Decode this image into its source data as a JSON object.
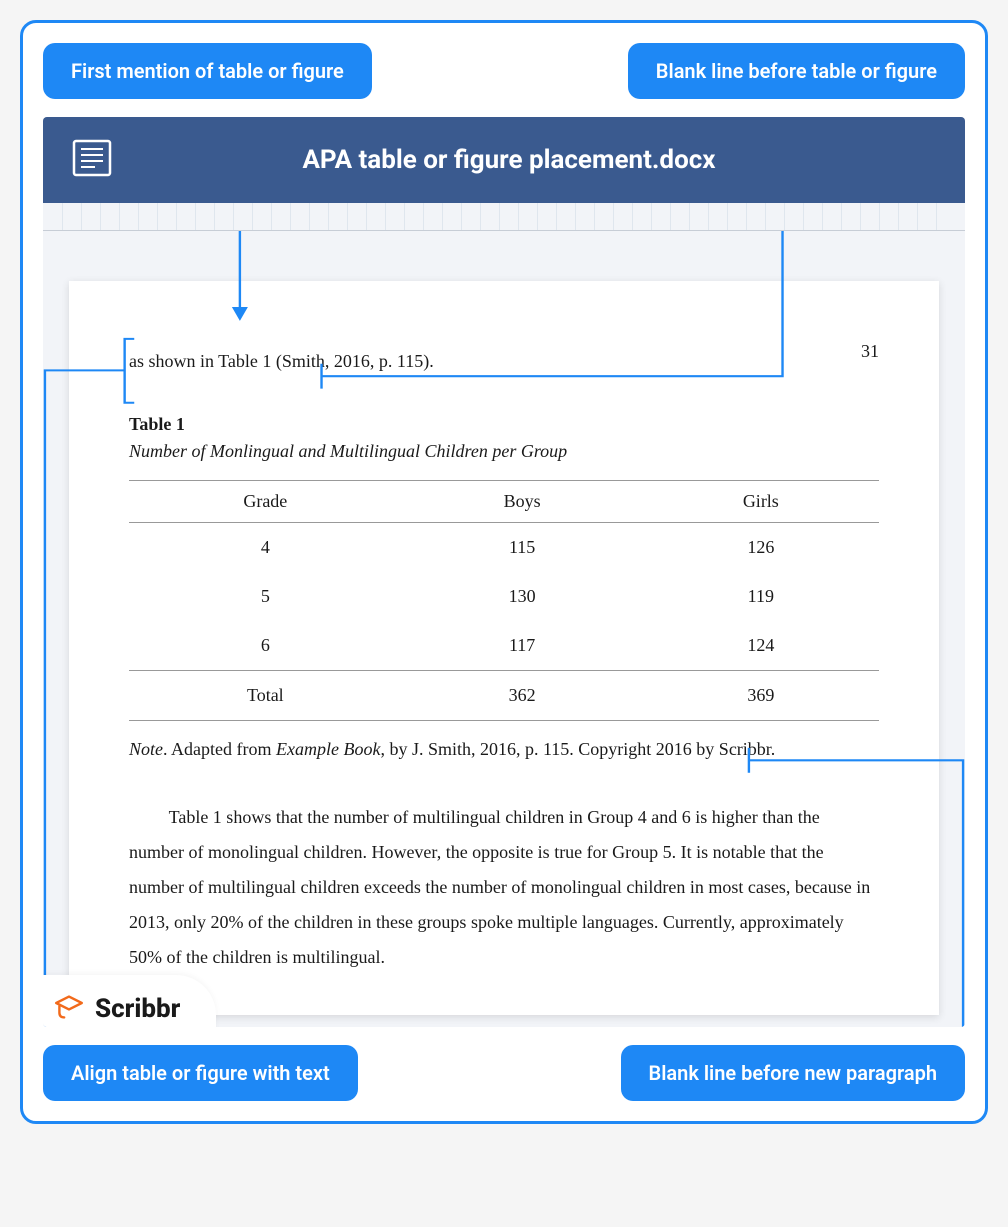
{
  "callouts": {
    "top_left": "First mention of table or figure",
    "top_right": "Blank line before table or figure",
    "bottom_left": "Align table or figure with text",
    "bottom_right": "Blank line before new paragraph"
  },
  "window": {
    "title": "APA table or figure placement.docx"
  },
  "page": {
    "number": "31",
    "intro": "as shown in Table 1 (Smith, 2016, p. 115).",
    "table_label": "Table 1",
    "table_title": "Number of Monlingual and Multilingual Children per Group",
    "columns": [
      "Grade",
      "Boys",
      "Girls"
    ],
    "rows": [
      {
        "grade": "4",
        "boys": "115",
        "girls": "126"
      },
      {
        "grade": "5",
        "boys": "130",
        "girls": "119"
      },
      {
        "grade": "6",
        "boys": "117",
        "girls": "124"
      }
    ],
    "total_row": {
      "grade": "Total",
      "boys": "362",
      "girls": "369"
    },
    "note_prefix_italic": "Note",
    "note_body1": ". Adapted from ",
    "note_book_italic": "Example Book",
    "note_body2": ", by J. Smith, 2016, p. 115. Copyright 2016 by Scribbr.",
    "body_paragraph": "Table 1 shows that the number of multilingual children in Group 4 and 6 is higher than the number of monolingual children. However, the opposite is true for Group 5. It is notable that the number of multilingual children exceeds the number of monolingual children in most cases, because in 2013, only 20% of the children in these groups spoke multiple languages. Currently, approximately 50% of the children is multilingual."
  },
  "brand": {
    "name": "Scribbr"
  }
}
